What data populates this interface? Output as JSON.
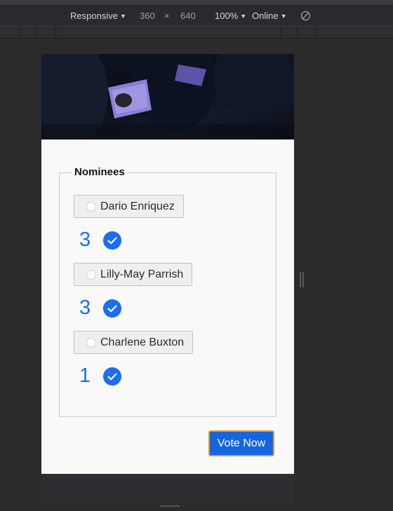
{
  "devtools": {
    "device_mode": "Responsive",
    "width": "360",
    "times": "×",
    "height": "640",
    "zoom": "100%",
    "throttle": "Online",
    "icons": {
      "caret": "caret-down-icon",
      "rotate": "rotate-icon"
    }
  },
  "form": {
    "legend": "Nominees",
    "nominees": [
      {
        "name": "Dario Enriquez",
        "votes": "3"
      },
      {
        "name": "Lilly-May Parrish",
        "votes": "3"
      },
      {
        "name": "Charlene Buxton",
        "votes": "1"
      }
    ],
    "submit_label": "Vote Now"
  },
  "colors": {
    "accent": "#1b6ef3",
    "vote_border": "#e09b2d",
    "devtools_bg": "#292a2d"
  }
}
